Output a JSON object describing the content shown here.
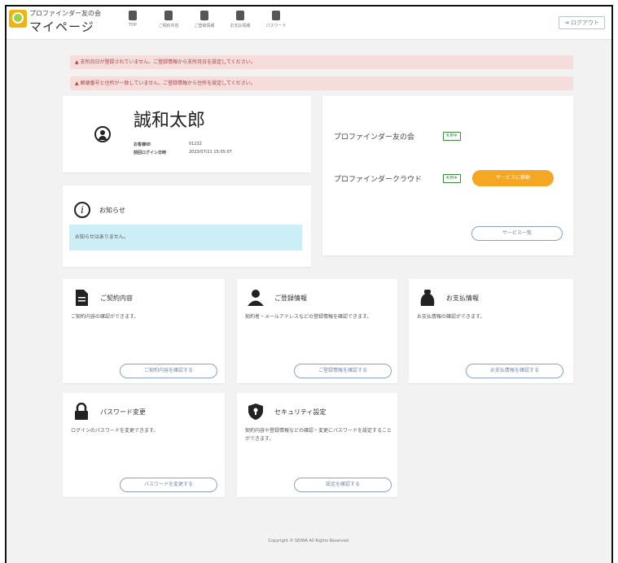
{
  "header": {
    "brand_small": "プロファインダー友の会",
    "brand_title": "マイページ",
    "nav": [
      {
        "icon": "home-icon",
        "label": "TOP"
      },
      {
        "icon": "document-icon",
        "label": "ご契約内容"
      },
      {
        "icon": "user-icon",
        "label": "ご登録情報"
      },
      {
        "icon": "wallet-icon",
        "label": "お支払情報"
      },
      {
        "icon": "lock-icon",
        "label": "パスワード"
      }
    ],
    "logout_label": "ログアウト"
  },
  "alerts": [
    "▲ 支所月日が登録されていません。ご登録情報から支所月日を設定してください。",
    "▲ 郵便番号と住所が一致していません。ご登録情報から住所を設定してください。"
  ],
  "user": {
    "name": "誠和太郎",
    "customer_no_label": "お客様ID",
    "customer_no": "01232",
    "last_login_label": "前回ログイン日時",
    "last_login": "2023/07/21 15:55:07"
  },
  "notice": {
    "title": "お知らせ",
    "empty_text": "お知らせはありません。"
  },
  "services": {
    "items": [
      {
        "name": "プロファインダー友の会",
        "badge": "利用中"
      },
      {
        "name": "プロファインダークラウド",
        "badge": "利用中",
        "action": "サービスに移動"
      }
    ],
    "list_button": "サービス一覧"
  },
  "features": [
    {
      "icon": "document-icon",
      "title": "ご契約内容",
      "desc": "ご契約内容の確認ができます。",
      "button": "ご契約内容を確認する"
    },
    {
      "icon": "user-icon",
      "title": "ご登録情報",
      "desc": "契約者・メールアドレスなどの登録情報を確認できます。",
      "button": "ご登録情報を確認する"
    },
    {
      "icon": "wallet-icon",
      "title": "お支払情報",
      "desc": "お支払情報の確認ができます。",
      "button": "お支払情報を確認する"
    },
    {
      "icon": "lock-icon",
      "title": "パスワード変更",
      "desc": "ログインのパスワードを変更できます。",
      "button": "パスワードを変更する"
    },
    {
      "icon": "shield-icon",
      "title": "セキュリティ設定",
      "desc": "契約内容や登録情報などの確認・変更にパスワードを設定することができます。",
      "button": "設定を確認する"
    }
  ],
  "footer": "Copyright © SEIWA All Rights Reserved."
}
